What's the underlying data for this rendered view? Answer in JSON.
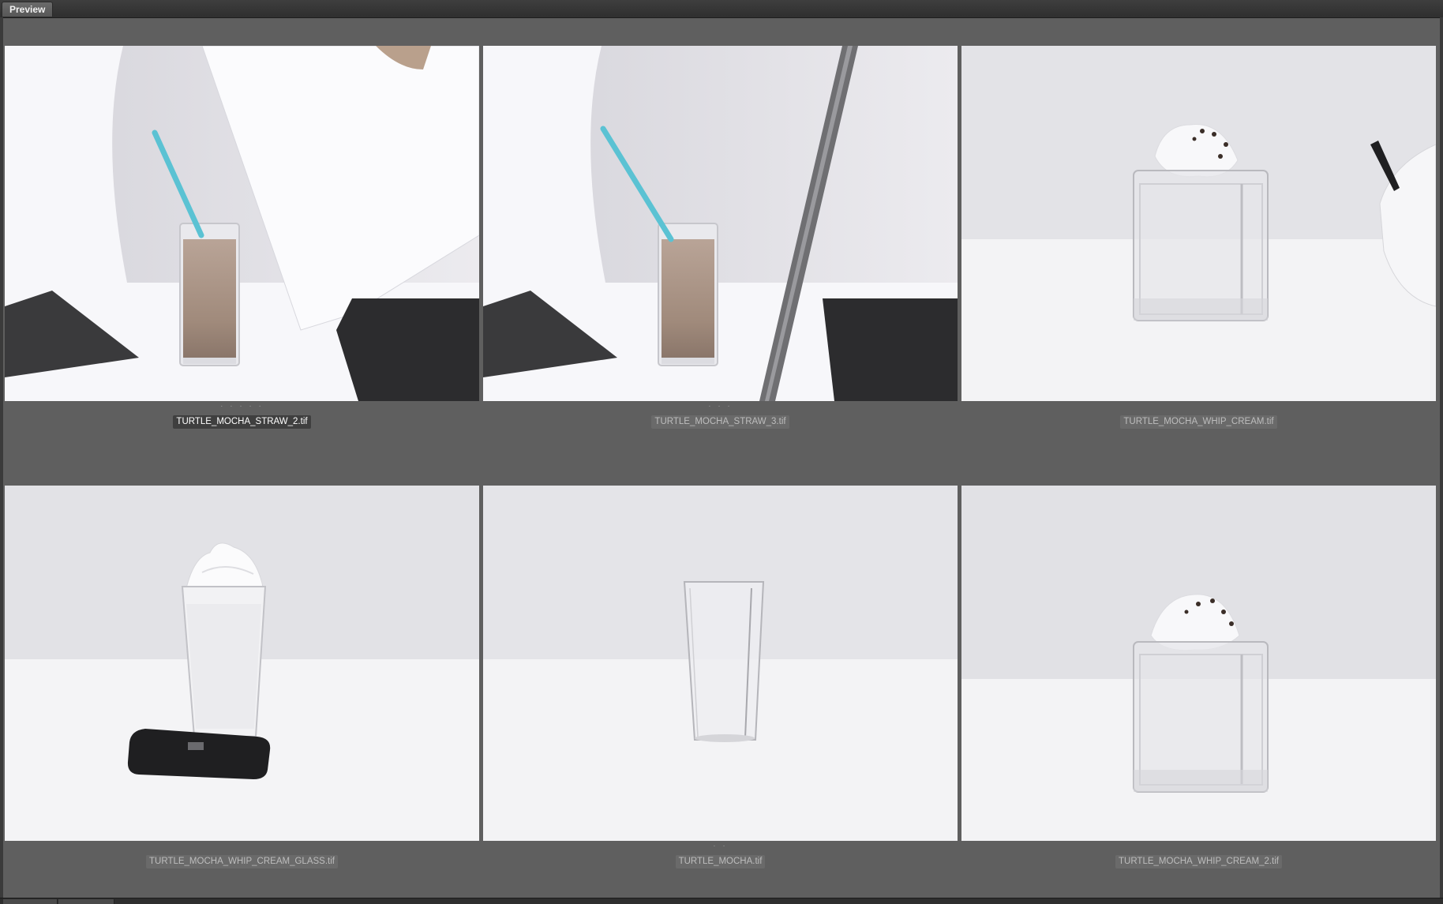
{
  "window": {
    "tab_label": "Preview"
  },
  "thumbnails": [
    {
      "filename": "TURTLE_MOCHA_STRAW_2.tif",
      "dots": "· · · · ·",
      "selected": true,
      "image": "milkshake-glass-with-straw"
    },
    {
      "filename": "TURTLE_MOCHA_STRAW_3.tif",
      "dots": "· · ·",
      "selected": false,
      "image": "milkshake-glass-with-straw"
    },
    {
      "filename": "TURTLE_MOCHA_WHIP_CREAM.tif",
      "dots": "",
      "selected": false,
      "image": "glass-cube-with-whipped-cream"
    },
    {
      "filename": "TURTLE_MOCHA_WHIP_CREAM_GLASS.tif",
      "dots": "",
      "selected": false,
      "image": "whipped-cream-glass-with-drive"
    },
    {
      "filename": "TURTLE_MOCHA.tif",
      "dots": "· ·",
      "selected": false,
      "image": "empty-tall-glass"
    },
    {
      "filename": "TURTLE_MOCHA_WHIP_CREAM_2.tif",
      "dots": "",
      "selected": false,
      "image": "glass-cube-with-whipped-cream"
    }
  ],
  "colors": {
    "background": "#5f5f5f",
    "frame": "#3b3b3b",
    "caption_selected_bg": "#3f3f3f",
    "caption_bg": "#6a6a6a",
    "straw": "#5bc2d3",
    "milkshake": "#a58f80"
  }
}
